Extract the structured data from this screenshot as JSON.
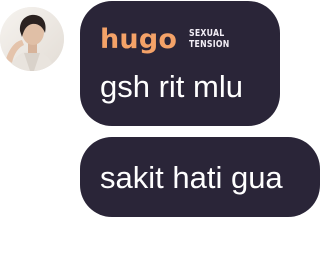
{
  "chat": {
    "sender": {
      "name": "hugo",
      "badge_line1": "SEXUAL",
      "badge_line2": "TENSION",
      "name_color": "#f4a268",
      "avatar_icon": "user-avatar-photo"
    },
    "bubble_color": "#2a2538",
    "messages": [
      {
        "text": "gsh rit mlu"
      },
      {
        "text": "sakit hati gua"
      }
    ]
  }
}
